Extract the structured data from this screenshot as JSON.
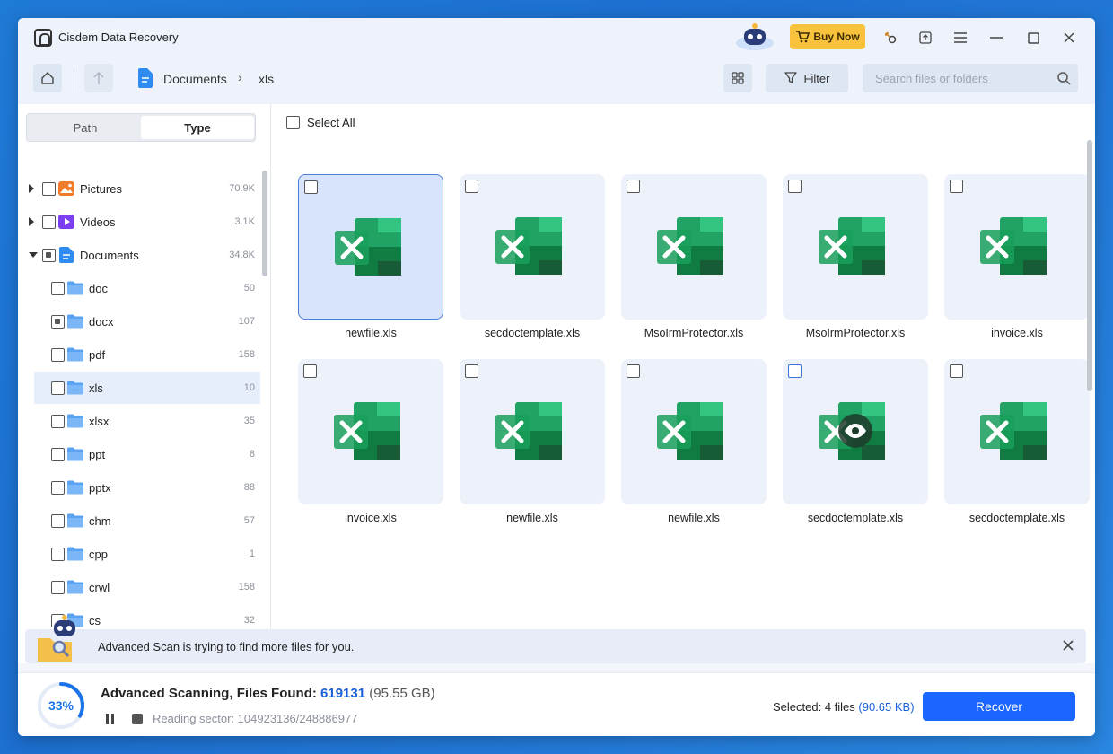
{
  "app": {
    "title": "Cisdem Data Recovery",
    "buy_now": "Buy Now"
  },
  "toolbar": {
    "breadcrumb": [
      "Documents",
      "xls"
    ],
    "filter_label": "Filter",
    "search_placeholder": "Search files or folders"
  },
  "sidebar": {
    "tabs": [
      {
        "label": "Path",
        "active": false
      },
      {
        "label": "Type",
        "active": true
      }
    ],
    "categories": [
      {
        "label": "Pictures",
        "count": "70.9K",
        "expanded": false
      },
      {
        "label": "Videos",
        "count": "3.1K",
        "expanded": false
      },
      {
        "label": "Documents",
        "count": "34.8K",
        "expanded": true
      }
    ],
    "folders": [
      {
        "label": "doc",
        "count": "50",
        "state": "unchecked"
      },
      {
        "label": "docx",
        "count": "107",
        "state": "partial"
      },
      {
        "label": "pdf",
        "count": "158",
        "state": "unchecked"
      },
      {
        "label": "xls",
        "count": "10",
        "state": "unchecked",
        "selected": true
      },
      {
        "label": "xlsx",
        "count": "35",
        "state": "unchecked"
      },
      {
        "label": "ppt",
        "count": "8",
        "state": "unchecked"
      },
      {
        "label": "pptx",
        "count": "88",
        "state": "unchecked"
      },
      {
        "label": "chm",
        "count": "57",
        "state": "unchecked"
      },
      {
        "label": "cpp",
        "count": "1",
        "state": "unchecked"
      },
      {
        "label": "crwl",
        "count": "158",
        "state": "unchecked"
      },
      {
        "label": "cs",
        "count": "32",
        "state": "unchecked"
      }
    ]
  },
  "main": {
    "select_all": "Select All",
    "files": [
      {
        "name": "newfile.xls",
        "selected": true
      },
      {
        "name": "secdoctemplate.xls"
      },
      {
        "name": "MsoIrmProtector.xls"
      },
      {
        "name": "MsoIrmProtector.xls"
      },
      {
        "name": "invoice.xls"
      },
      {
        "name": "invoice.xls"
      },
      {
        "name": "newfile.xls"
      },
      {
        "name": "newfile.xls"
      },
      {
        "name": "secdoctemplate.xls",
        "hover_preview": true
      },
      {
        "name": "secdoctemplate.xls"
      }
    ]
  },
  "notice": {
    "text": "Advanced Scan is trying to find more files for you."
  },
  "status": {
    "progress_percent": 33,
    "progress_label": "33%",
    "scan_title": "Advanced Scanning, Files Found: ",
    "files_found": "619131",
    "found_size": "(95.55 GB)",
    "sector": "Reading sector: 104923136/248886977",
    "selected_prefix": "Selected: 4 files ",
    "selected_size": "(90.65 KB)",
    "recover_label": "Recover"
  },
  "colors": {
    "accent": "#1a66ff",
    "excel_green": "#1d9a5a",
    "buy_now": "#f8c23c"
  }
}
